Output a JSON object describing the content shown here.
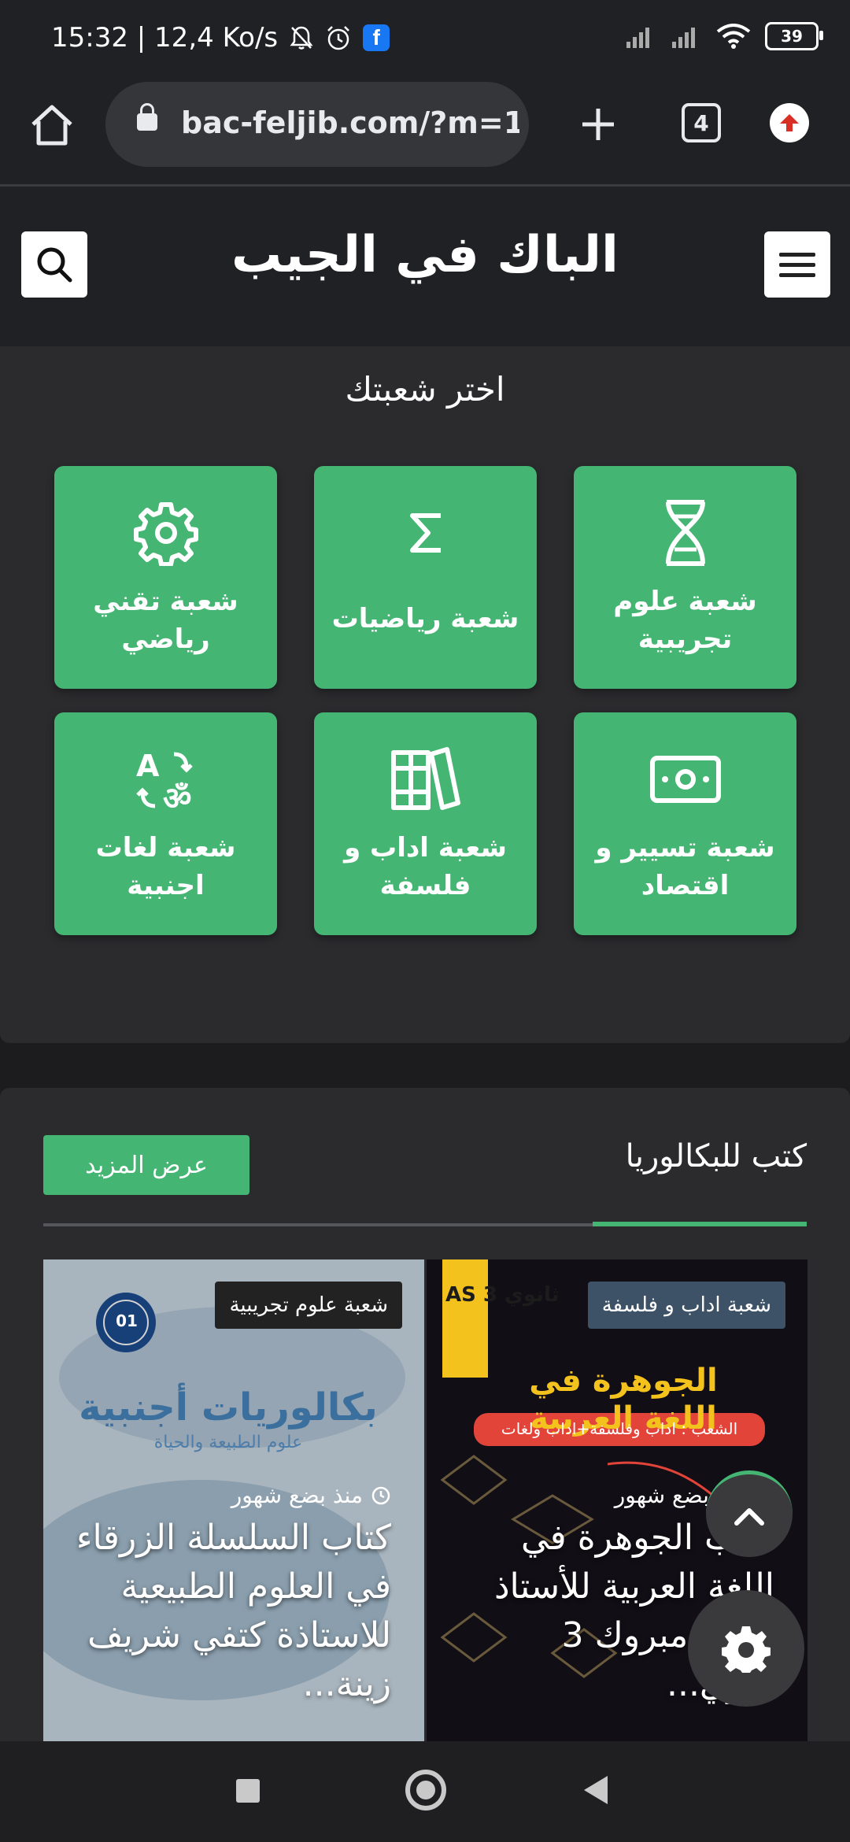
{
  "status_bar": {
    "time_speed": "15:32 | 12,4 Ko/s",
    "battery": "39",
    "notification_icons": [
      "bell-off-icon",
      "alarm-icon",
      "facebook-icon"
    ],
    "system_icons": [
      "signal-icon",
      "signal-icon",
      "wifi-icon",
      "battery-icon"
    ]
  },
  "browser": {
    "url": "bac-feljib.com/?m=1",
    "tab_count": "4"
  },
  "header": {
    "title": "الباك في الجيب"
  },
  "branches": {
    "heading": "اختر شعبتك",
    "items": [
      {
        "label": "شعبة علوم تجريبية",
        "icon": "dna-icon"
      },
      {
        "label": "شعبة رياضيات",
        "icon": "sigma-icon"
      },
      {
        "label": "شعبة تقني رياضي",
        "icon": "gear-icon"
      },
      {
        "label": "شعبة تسيير و اقتصاد",
        "icon": "money-icon"
      },
      {
        "label": "شعبة اداب و فلسفة",
        "icon": "books-icon"
      },
      {
        "label": "شعبة لغات اجنبية",
        "icon": "translate-icon"
      }
    ]
  },
  "books": {
    "heading": "كتب للبكالوريا",
    "more_label": "عرض المزيد",
    "items": [
      {
        "tag": "شعبة اداب و فلسفة",
        "time": "منذ بضع شهور",
        "title": "كتاب الجوهرة في اللغة العربية للأستاذ بوبكر مبروك 3 ثانوي...",
        "cover_text": "الجوهرة في اللغة العربية",
        "cover_sub": "الشعب : اداب وفلسفة+اداب ولغات",
        "cover_badge": "AS 3 ثانوي"
      },
      {
        "tag": "شعبة علوم تجريبية",
        "time": "منذ بضع شهور",
        "title": "كتاب السلسلة الزرقاء في العلوم الطبيعية للاستاذة كتفي شريف زينة...",
        "cover_text": "بكالوريات أجنبية",
        "cover_sub": "علوم الطبيعة والحياة",
        "cover_badge": "01"
      }
    ]
  },
  "fabs": [
    "chevron-up-icon",
    "gear-icon"
  ],
  "nav": [
    "recents-button",
    "home-button",
    "back-button"
  ]
}
